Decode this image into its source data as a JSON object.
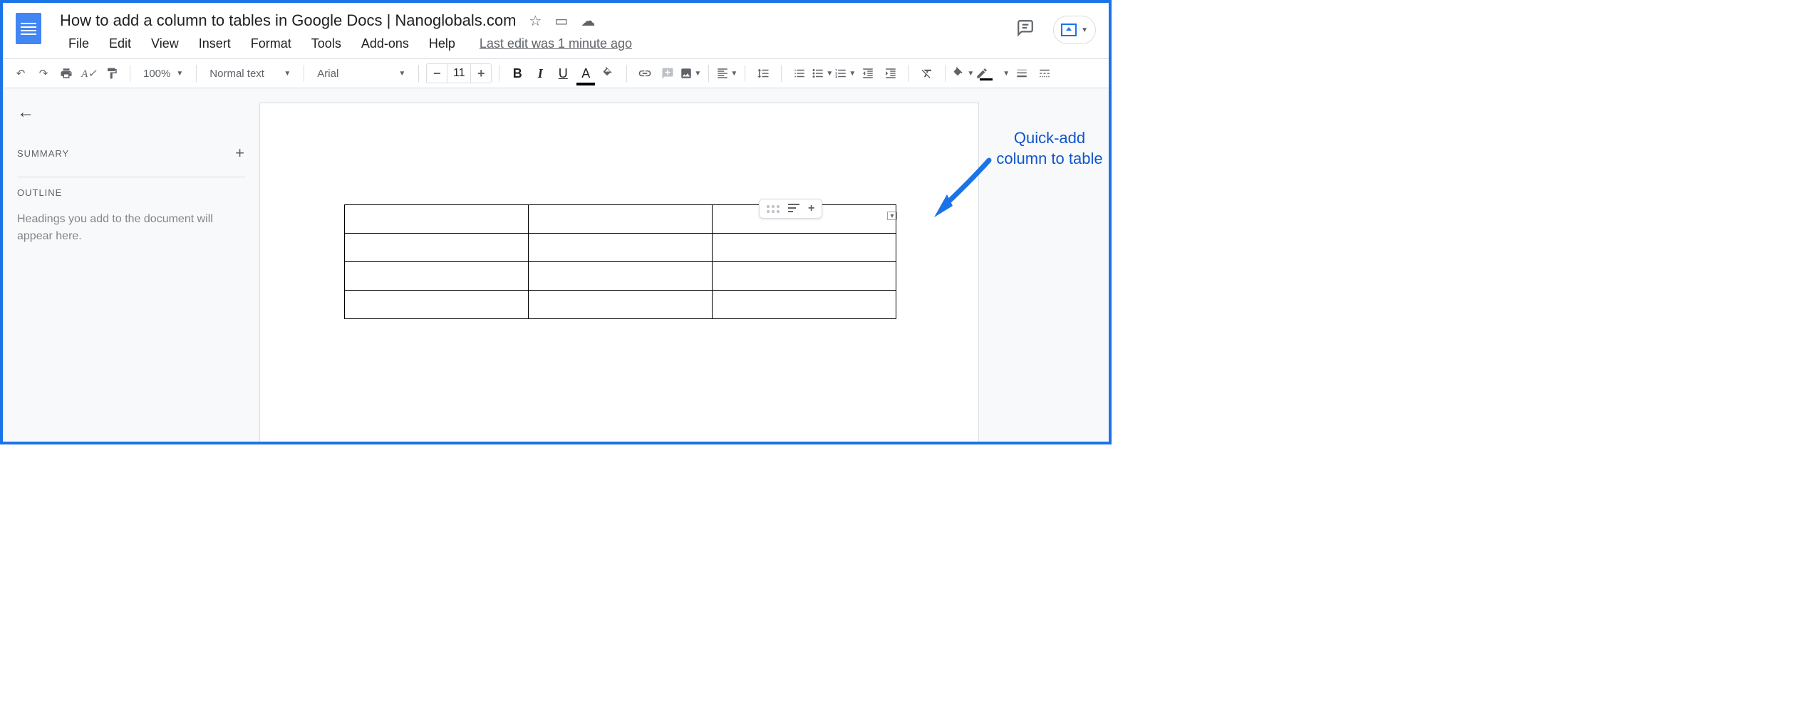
{
  "header": {
    "title": "How to add a column to tables in Google Docs | Nanoglobals.com",
    "lastEdit": "Last edit was 1 minute ago"
  },
  "menus": [
    "File",
    "Edit",
    "View",
    "Insert",
    "Format",
    "Tools",
    "Add-ons",
    "Help"
  ],
  "toolbar": {
    "zoom": "100%",
    "style": "Normal text",
    "font": "Arial",
    "size": "11"
  },
  "sidebar": {
    "summaryLabel": "SUMMARY",
    "outlineLabel": "OUTLINE",
    "outlineHelp": "Headings you add to the document will appear here."
  },
  "table": {
    "rows": 4,
    "cols": 3
  },
  "annotation": "Quick-add column to table"
}
